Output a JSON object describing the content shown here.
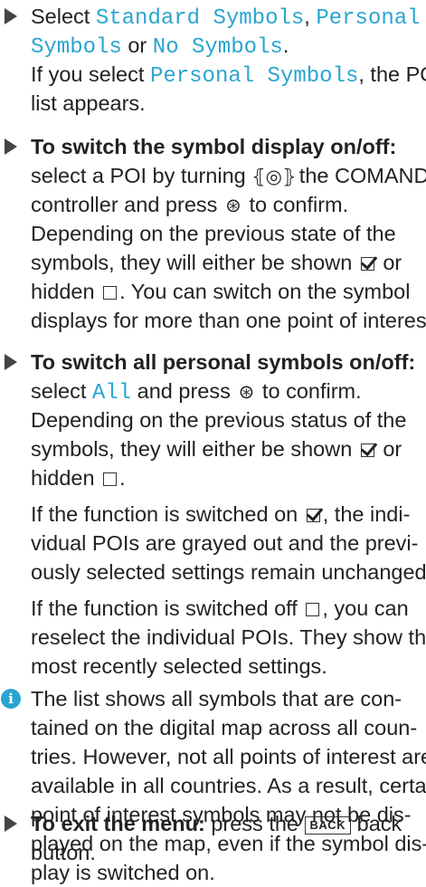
{
  "step1": {
    "prefix": "Select ",
    "opt1": "Standard Symbols",
    "sep1": ", ",
    "opt2a": "Personal",
    "opt2b": "Symbols",
    "sep2": " or ",
    "opt3": "No Symbols",
    "end": ".",
    "if": "If you select ",
    "opt2full": "Personal Symbols",
    "poi_a": ", the POI",
    "poi_b": "list appears."
  },
  "step2": {
    "heading": "To switch the symbol display on/off:",
    "l2a": "select a POI by turning ",
    "l2b": " the COMAND",
    "l3a": "controller and press ",
    "l3b": " to confirm.",
    "l4": "Depending on the previous state of the",
    "l5a": "symbols, they will either be shown ",
    "l5b": " or",
    "l6a": "hidden ",
    "l6b": ". You can switch on the symbol",
    "l7": "displays for more than one point of interest."
  },
  "step3": {
    "heading": "To switch all personal symbols on/off:",
    "l2a": "select ",
    "all": "All",
    "l2b": " and press ",
    "l2c": " to confirm.",
    "l3": "Depending on the previous status of the",
    "l4a": "symbols, they will either be shown ",
    "l4b": " or",
    "l5a": "hidden ",
    "l5b": ".",
    "p2l1a": "If the function is switched on ",
    "p2l1b": ", the indi-",
    "p2l2": "vidual POIs are grayed out and the previ-",
    "p2l3": "ously selected settings remain unchanged.",
    "p3l1a": "If the function is switched off ",
    "p3l1b": ", you can",
    "p3l2": "reselect the individual POIs. They show the",
    "p3l3": "most recently selected settings."
  },
  "note": {
    "icon": "i",
    "l1": "The list shows all symbols that are con-",
    "l2": "tained on the digital map across all coun-",
    "l3": "tries. However, not all points of interest are",
    "l4": "available in all countries. As a result, certain",
    "l5": "point of interest symbols may not be dis-",
    "l6": "played on the map, even if the symbol dis-",
    "l7": "play is switched on."
  },
  "step4": {
    "heading": "To exit the menu:",
    "l1a": " press the ",
    "key": "BACK",
    "l1b": " back",
    "l2": "button."
  },
  "symbols": {
    "controller": "⦃◎⦄",
    "press": "⊛"
  },
  "colors": {
    "accent": "#2aa5cf",
    "text": "#222222"
  }
}
